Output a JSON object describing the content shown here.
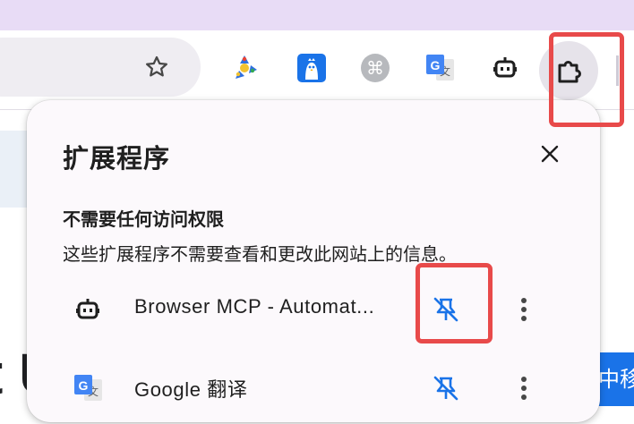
{
  "toolbar": {
    "bookmark_icon": "star-outline-icon",
    "extension_icons": [
      {
        "name": "colorful-spinner-extension-icon",
        "color": "#2f6fe0"
      },
      {
        "name": "bird-extension-icon",
        "color": "#1a73e8"
      },
      {
        "name": "command-key-extension-icon",
        "color": "#9aa0a6"
      },
      {
        "name": "google-translate-extension-icon",
        "color": "#4285f4"
      },
      {
        "name": "robot-extension-icon",
        "color": "#1f1f1f"
      }
    ],
    "extensions_menu_icon": "puzzle-piece-icon"
  },
  "popup": {
    "title": "扩展程序",
    "close_icon": "close-icon",
    "section": {
      "heading": "不需要任何访问权限",
      "description": "这些扩展程序不需要查看和更改此网站上的信息。"
    },
    "extensions": [
      {
        "name": "Browser MCP - Automat...",
        "icon": "robot-icon",
        "pin_icon": "unpin-icon",
        "menu_icon": "more-vert-icon"
      },
      {
        "name": "Google 翻译",
        "icon": "google-translate-icon",
        "pin_icon": "unpin-icon",
        "menu_icon": "more-vert-icon"
      }
    ]
  },
  "page": {
    "partial_heading_text": "t U",
    "partial_badge_text": "中移"
  },
  "colors": {
    "top_band": "#e8dcf6",
    "popup_background": "#fcf9fc",
    "pin_active": "#1a73e8",
    "highlight": "#e84a4a"
  }
}
